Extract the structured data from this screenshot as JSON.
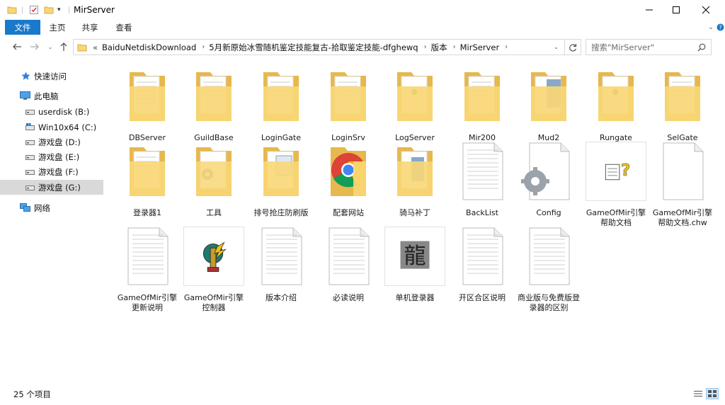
{
  "title": "MirServer",
  "ribbon": {
    "file": "文件",
    "home": "主页",
    "share": "共享",
    "view": "查看"
  },
  "address": {
    "overflow": "«",
    "crumbs": [
      "BaiduNetdiskDownload",
      "5月新原始冰雪随机鉴定技能复古-拾取鉴定技能-dfghewq",
      "版本",
      "MirServer"
    ]
  },
  "search": {
    "placeholder": "搜索\"MirServer\""
  },
  "nav": {
    "quick": "快速访问",
    "pc": "此电脑",
    "drives": [
      "userdisk (B:)",
      "Win10x64 (C:)",
      "游戏盘 (D:)",
      "游戏盘 (E:)",
      "游戏盘 (F:)",
      "游戏盘 (G:)"
    ],
    "network": "网络"
  },
  "items": [
    "DBServer",
    "GuildBase",
    "LoginGate",
    "LoginSrv",
    "LogServer",
    "Mir200",
    "Mud2",
    "Rungate",
    "SelGate",
    "登录器1",
    "工具",
    "排号抢庄防刷版",
    "配套网站",
    "骑马补丁",
    "BackList",
    "Config",
    "GameOfMir引擎帮助文档",
    "GameOfMir引擎帮助文档.chw",
    "GameOfMir引擎更新说明",
    "GameOfMir引擎控制器",
    "版本介绍",
    "必读说明",
    "单机登录器",
    "开区合区说明",
    "商业版与免费版登录器的区别"
  ],
  "status": {
    "count": "25 个项目"
  },
  "colors": {
    "accent": "#1979ca",
    "folder": "#f8d775",
    "selection": "#d9d9d9"
  }
}
